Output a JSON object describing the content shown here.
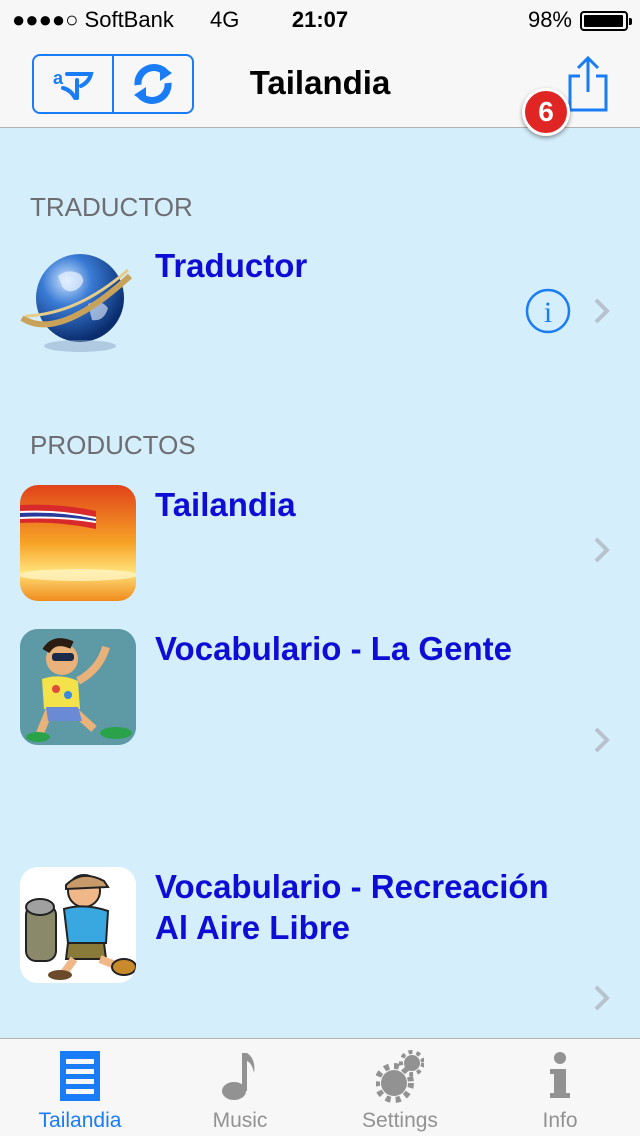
{
  "status_bar": {
    "carrier": "●●●●○ SoftBank",
    "network": "4G",
    "time": "21:07",
    "battery_pct": "98%",
    "battery_level": 0.98
  },
  "nav": {
    "title": "Tailandia",
    "translate_icon": "translate-icon",
    "swap_icon": "swap-icon",
    "share_icon": "share-icon",
    "badge_count": "6"
  },
  "sections": [
    {
      "header": "TRADUCTOR",
      "rows": [
        {
          "title": "Traductor",
          "icon": "globe-icon",
          "has_info": true
        }
      ]
    },
    {
      "header": "PRODUCTOS",
      "rows": [
        {
          "title": "Tailandia",
          "icon": "thailand-flag-sunset-icon"
        },
        {
          "title": "Vocabulario - La Gente",
          "icon": "tourist-man-icon"
        },
        {
          "title_line1": "Vocabulario - Recreación",
          "title_line2": "Al Aire Libre",
          "icon": "hiker-icon"
        }
      ]
    }
  ],
  "tabs": [
    {
      "label": "Tailandia",
      "icon": "list-icon",
      "active": true
    },
    {
      "label": "Music",
      "icon": "music-note-icon",
      "active": false
    },
    {
      "label": "Settings",
      "icon": "gears-icon",
      "active": false
    },
    {
      "label": "Info",
      "icon": "info-icon",
      "active": false
    }
  ],
  "colors": {
    "accent": "#1a7cf6",
    "row_title": "#0d0dd6",
    "background": "#d4eefb",
    "badge": "#e02525"
  }
}
